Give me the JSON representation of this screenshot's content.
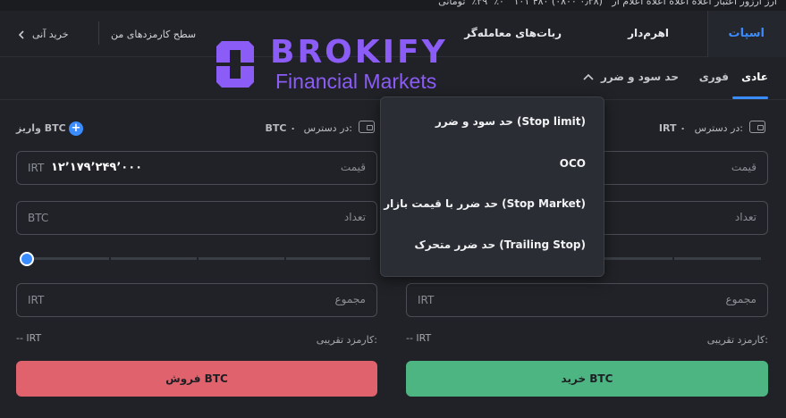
{
  "top_strip": {
    "ticker": "ارز ارزور اعتبار اعلاه اعلاه اعلاه اعلام ار   (۰٫۳۸ ۰۸۰۰) ۱۰۱٬۴۸۰   ۰٪  ۳۹٪  تومانی",
    "ticker_green": "تومان"
  },
  "header": {
    "tabs": {
      "spot": "اسپات",
      "leverage": "اهرم‌دار",
      "trading_bots": "ربات‌های معامله‌گر"
    },
    "fee_level": "سطح کارمزدهای من",
    "instant_buy": "خرید آنی"
  },
  "logo": {
    "wordmark": "BROKIFY",
    "tagline": "Financial Markets"
  },
  "order_tabs": {
    "normal": "عادی",
    "instant": "فوری",
    "tp_sl": "حد سود و ضرر"
  },
  "dropdown": {
    "items": [
      "حد سود و ضرر (Stop limit)",
      "OCO",
      "حد ضرر با قیمت بازار (Stop Market)",
      "حد ضرر متحرک (Trailing Stop)"
    ]
  },
  "buy_panel": {
    "available_label": "در دسترس:",
    "available_value": "IRT ۰",
    "price_placeholder": "قیمت",
    "amount_placeholder": "تعداد",
    "total_placeholder": "مجموع",
    "total_unit": "IRT",
    "fee_label": "کارمزد تقریبی:",
    "fee_value": "-- IRT",
    "button": "خرید BTC"
  },
  "sell_panel": {
    "deposit_label": "واریز BTC",
    "available_label": "در دسترس:",
    "available_value": "BTC ۰",
    "price_placeholder": "قیمت",
    "price_unit": "IRT",
    "price_value": "۱۲٬۱۷۹٬۲۴۹٬۰۰۰",
    "amount_placeholder": "تعداد",
    "amount_unit": "BTC",
    "total_placeholder": "مجموع",
    "total_unit": "IRT",
    "fee_label": "کارمزد تقریبی:",
    "fee_value": "-- IRT",
    "button": "فروش BTC"
  },
  "colors": {
    "accent": "#3a8cff",
    "buy": "#4cb582",
    "sell": "#e0626d",
    "logo": "#8b5cf6"
  }
}
